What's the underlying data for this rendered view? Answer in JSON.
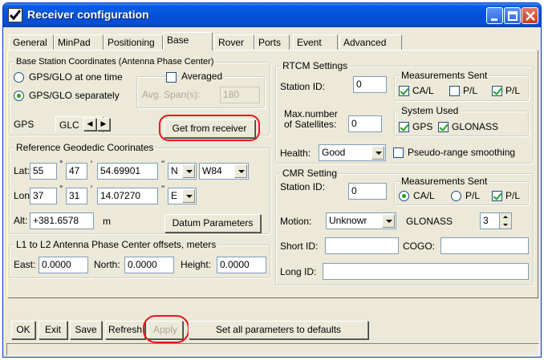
{
  "window": {
    "title": "Receiver configuration"
  },
  "tabs": [
    "General",
    "MinPad",
    "Positioning",
    "Base",
    "Rover",
    "Ports",
    "Event",
    "Advanced"
  ],
  "active_tab": "Base",
  "base_station": {
    "legend": "Base Station Coordinates (Antenna Phase Center)",
    "radio_once": "GPS/GLO at one time",
    "radio_separately": "GPS/GLO separately",
    "averaged_label": "Averaged",
    "avg_span_label": "Avg. Span(s):",
    "avg_span_value": "180",
    "sub_tab_gps": "GPS",
    "sub_tab_glo": "GLC",
    "get_from_receiver": "Get from receiver"
  },
  "geodetic": {
    "legend": "Reference Geodedic Coorinates",
    "lat_label": "Lat:",
    "lat_deg": "55",
    "lat_min": "47",
    "lat_sec": "54.69901",
    "lat_hemi": "N",
    "datum": "W84",
    "lon_label": "Lon:",
    "lon_deg": "37",
    "lon_min": "31",
    "lon_sec": "14.07270",
    "lon_hemi": "E",
    "deg_mark": "°",
    "min_mark": "'",
    "sec_mark": "''",
    "alt_label": "Alt:",
    "alt_value": "+381.6578",
    "alt_unit": "m",
    "datum_params": "Datum Parameters"
  },
  "offsets": {
    "legend": "L1 to L2 Antenna Phase Center offsets, meters",
    "east_label": "East:",
    "east_value": "0.0000",
    "north_label": "North:",
    "north_value": "0.0000",
    "height_label": "Height:",
    "height_value": "0.0000"
  },
  "rtcm": {
    "legend": "RTCM Settings",
    "station_id_label": "Station ID:",
    "station_id_value": "0",
    "max_sat_label_1": "Max.number",
    "max_sat_label_2": "of Satellites:",
    "max_sat_value": "0",
    "measurements_legend": "Measurements Sent",
    "ca_l": "CA/L",
    "p_l1": "P/L",
    "p_l2": "P/L",
    "system_legend": "System Used",
    "gps": "GPS",
    "glonass": "GLONASS",
    "health_label": "Health:",
    "health_value": "Good",
    "pseudo_range": "Pseudo-range smoothing"
  },
  "cmr": {
    "legend": "CMR Setting",
    "station_id_label": "Station ID:",
    "station_id_value": "0",
    "measurements_legend": "Measurements Sent",
    "ca_l": "CA/L",
    "p_l1": "P/L",
    "p_l2": "P/L",
    "motion_label": "Motion:",
    "motion_value": "Unknowr",
    "glonass_label": "GLONASS",
    "glonass_value": "3",
    "short_id_label": "Short ID:",
    "cogo_label": "COGO:",
    "long_id_label": "Long ID:"
  },
  "buttons": {
    "ok": "OK",
    "exit": "Exit",
    "save": "Save",
    "refresh": "Refresh",
    "apply": "Apply",
    "defaults": "Set all parameters to defaults"
  },
  "colors": {
    "titlebar": "#0251d8",
    "highlight": "#e8151c",
    "checkmark": "#21a121"
  }
}
